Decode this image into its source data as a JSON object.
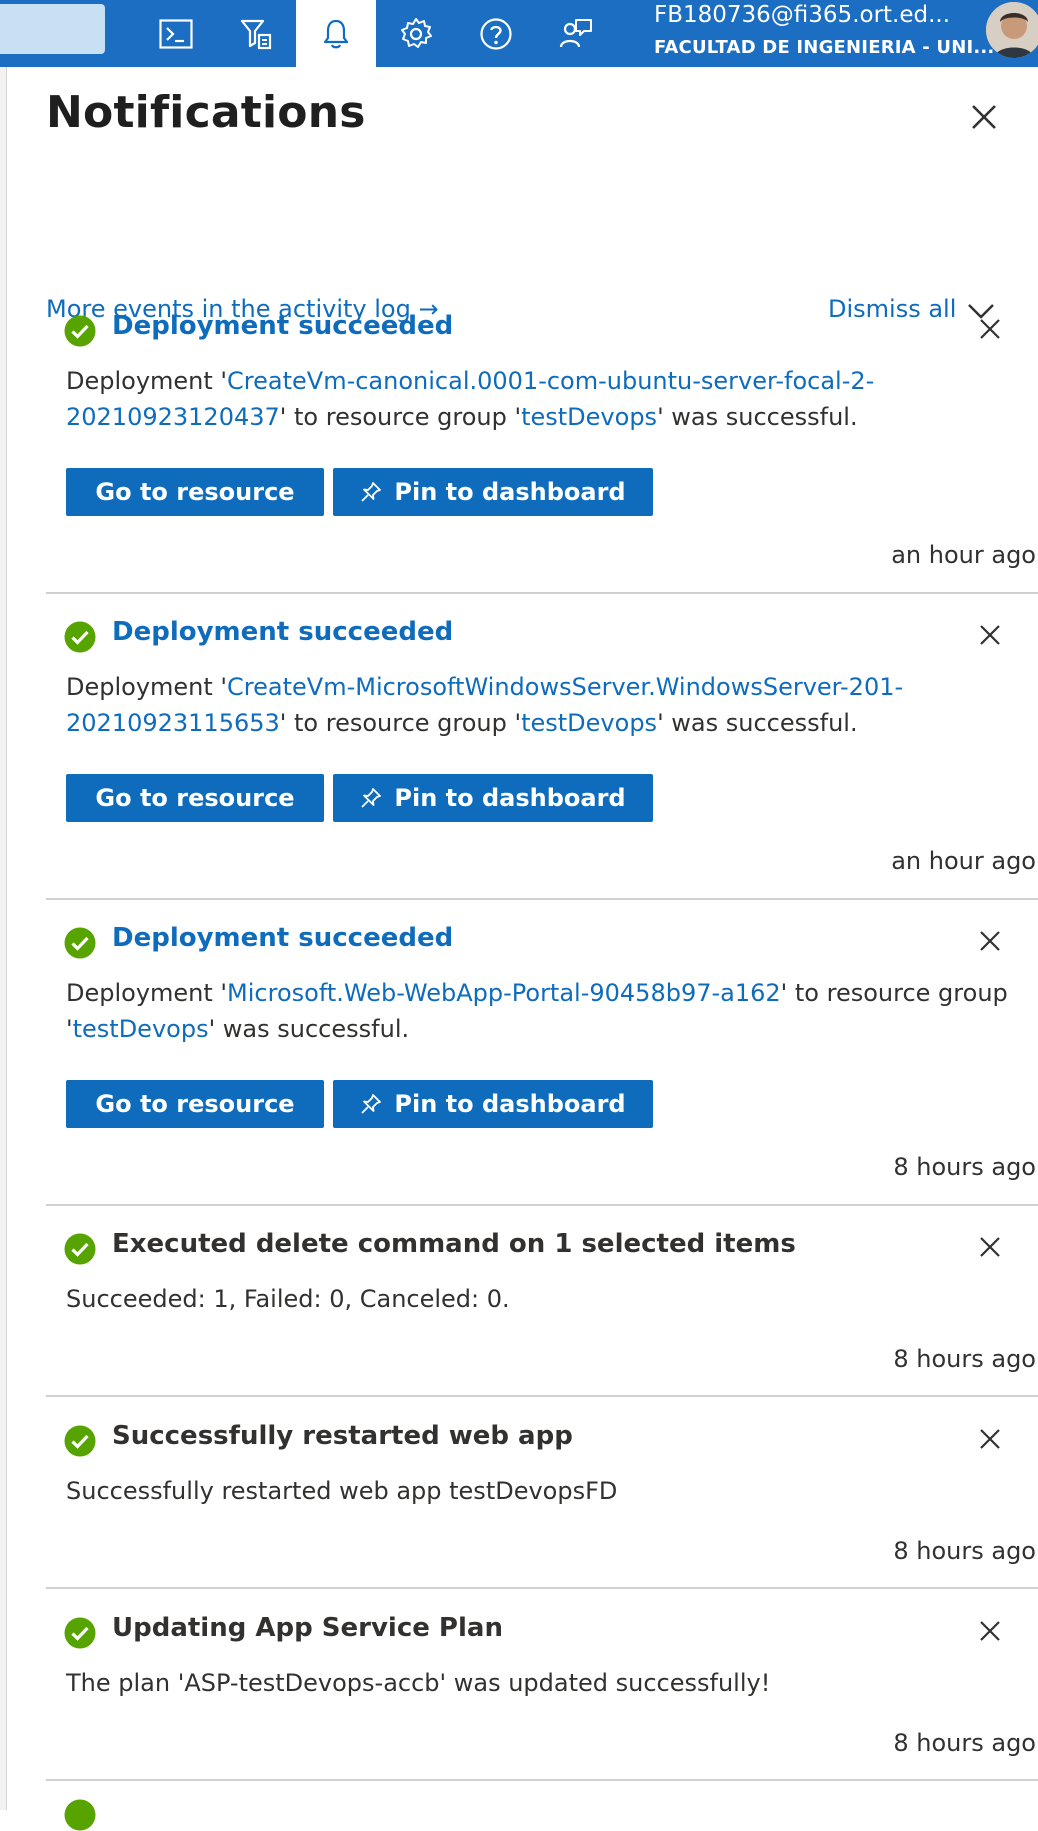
{
  "topbar": {
    "icons": [
      "cloud-shell-icon",
      "directory-filter-icon",
      "bell-icon",
      "gear-icon",
      "help-icon",
      "feedback-icon"
    ],
    "account_name": "FB180736@fi365.ort.ed...",
    "account_org": "FACULTAD DE INGENIERIA - UNI..."
  },
  "panel": {
    "title": "Notifications",
    "activity_link": "More events in the activity log",
    "activity_arrow": "→",
    "dismiss_all": "Dismiss all"
  },
  "notifications": [
    {
      "title": "Deployment succeeded",
      "body_prefix": "Deployment '",
      "deployment_name": "CreateVm-canonical.0001-com-ubuntu-server-focal-2-20210923120437",
      "body_mid": "' to resource group '",
      "resource_group": "testDevops",
      "body_suffix": "' was successful.",
      "go_label": "Go to resource",
      "pin_label": "Pin to dashboard",
      "time": "an hour ago"
    },
    {
      "title": "Deployment succeeded",
      "body_prefix": "Deployment '",
      "deployment_name": "CreateVm-MicrosoftWindowsServer.WindowsServer-201-20210923115653",
      "body_mid": "' to resource group '",
      "resource_group": "testDevops",
      "body_suffix": "' was successful.",
      "go_label": "Go to resource",
      "pin_label": "Pin to dashboard",
      "time": "an hour ago"
    },
    {
      "title": "Deployment succeeded",
      "body_prefix": "Deployment '",
      "deployment_name": "Microsoft.Web-WebApp-Portal-90458b97-a162",
      "body_mid": "' to resource group '",
      "resource_group": "testDevops",
      "body_suffix": "' was successful.",
      "go_label": "Go to resource",
      "pin_label": "Pin to dashboard",
      "time": "8 hours ago"
    },
    {
      "title": "Executed delete command on 1 selected items",
      "body": "Succeeded: 1, Failed: 0, Canceled: 0.",
      "time": "8 hours ago"
    },
    {
      "title": "Successfully restarted web app",
      "body": "Successfully restarted web app testDevopsFD",
      "time": "8 hours ago"
    },
    {
      "title": "Updating App Service Plan",
      "body": "The plan 'ASP-testDevops-accb' was updated successfully!",
      "time": "8 hours ago"
    }
  ],
  "colors": {
    "topbar": "#1b6ec2",
    "link": "#0f6cbd",
    "button": "#0f6cbd",
    "success": "#57a300"
  }
}
